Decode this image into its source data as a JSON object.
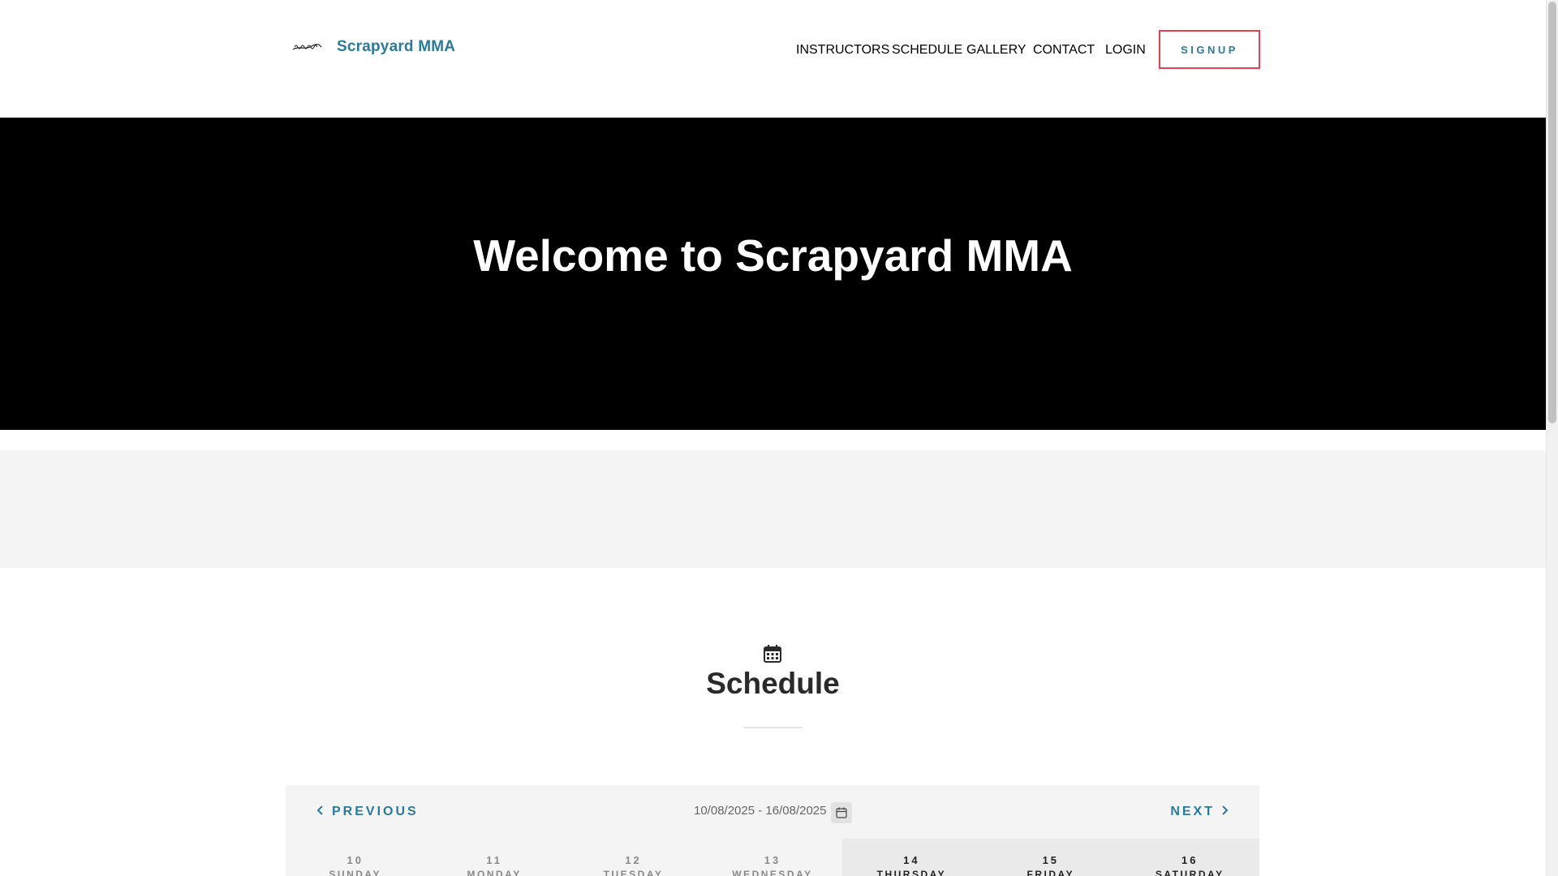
{
  "brand": {
    "name": "Scrapyard MMA",
    "logo_text": "Scrapyard"
  },
  "nav": {
    "items": [
      {
        "label": "INSTRUCTORS"
      },
      {
        "label": "SCHEDULE"
      },
      {
        "label": "GALLERY"
      },
      {
        "label": "CONTACT"
      },
      {
        "label": "LOGIN"
      }
    ],
    "signup_label": "SIGNUP"
  },
  "hero": {
    "title": "Welcome to Scrapyard MMA"
  },
  "schedule": {
    "icon": "calendar-icon",
    "title": "Schedule",
    "previous_label": "PREVIOUS",
    "next_label": "NEXT",
    "date_range": "10/08/2025 - 16/08/2025",
    "days": [
      {
        "num": "10",
        "weekday": "SUNDAY"
      },
      {
        "num": "11",
        "weekday": "MONDAY"
      },
      {
        "num": "12",
        "weekday": "TUESDAY"
      },
      {
        "num": "13",
        "weekday": "WEDNESDAY"
      },
      {
        "num": "14",
        "weekday": "THURSDAY"
      },
      {
        "num": "15",
        "weekday": "FRIDAY"
      },
      {
        "num": "16",
        "weekday": "SATURDAY"
      }
    ],
    "current_days": [
      "14",
      "15",
      "16"
    ]
  },
  "colors": {
    "accent": "#2b7a99",
    "signup_border": "#e0404f",
    "hero_bg": "#000000"
  }
}
